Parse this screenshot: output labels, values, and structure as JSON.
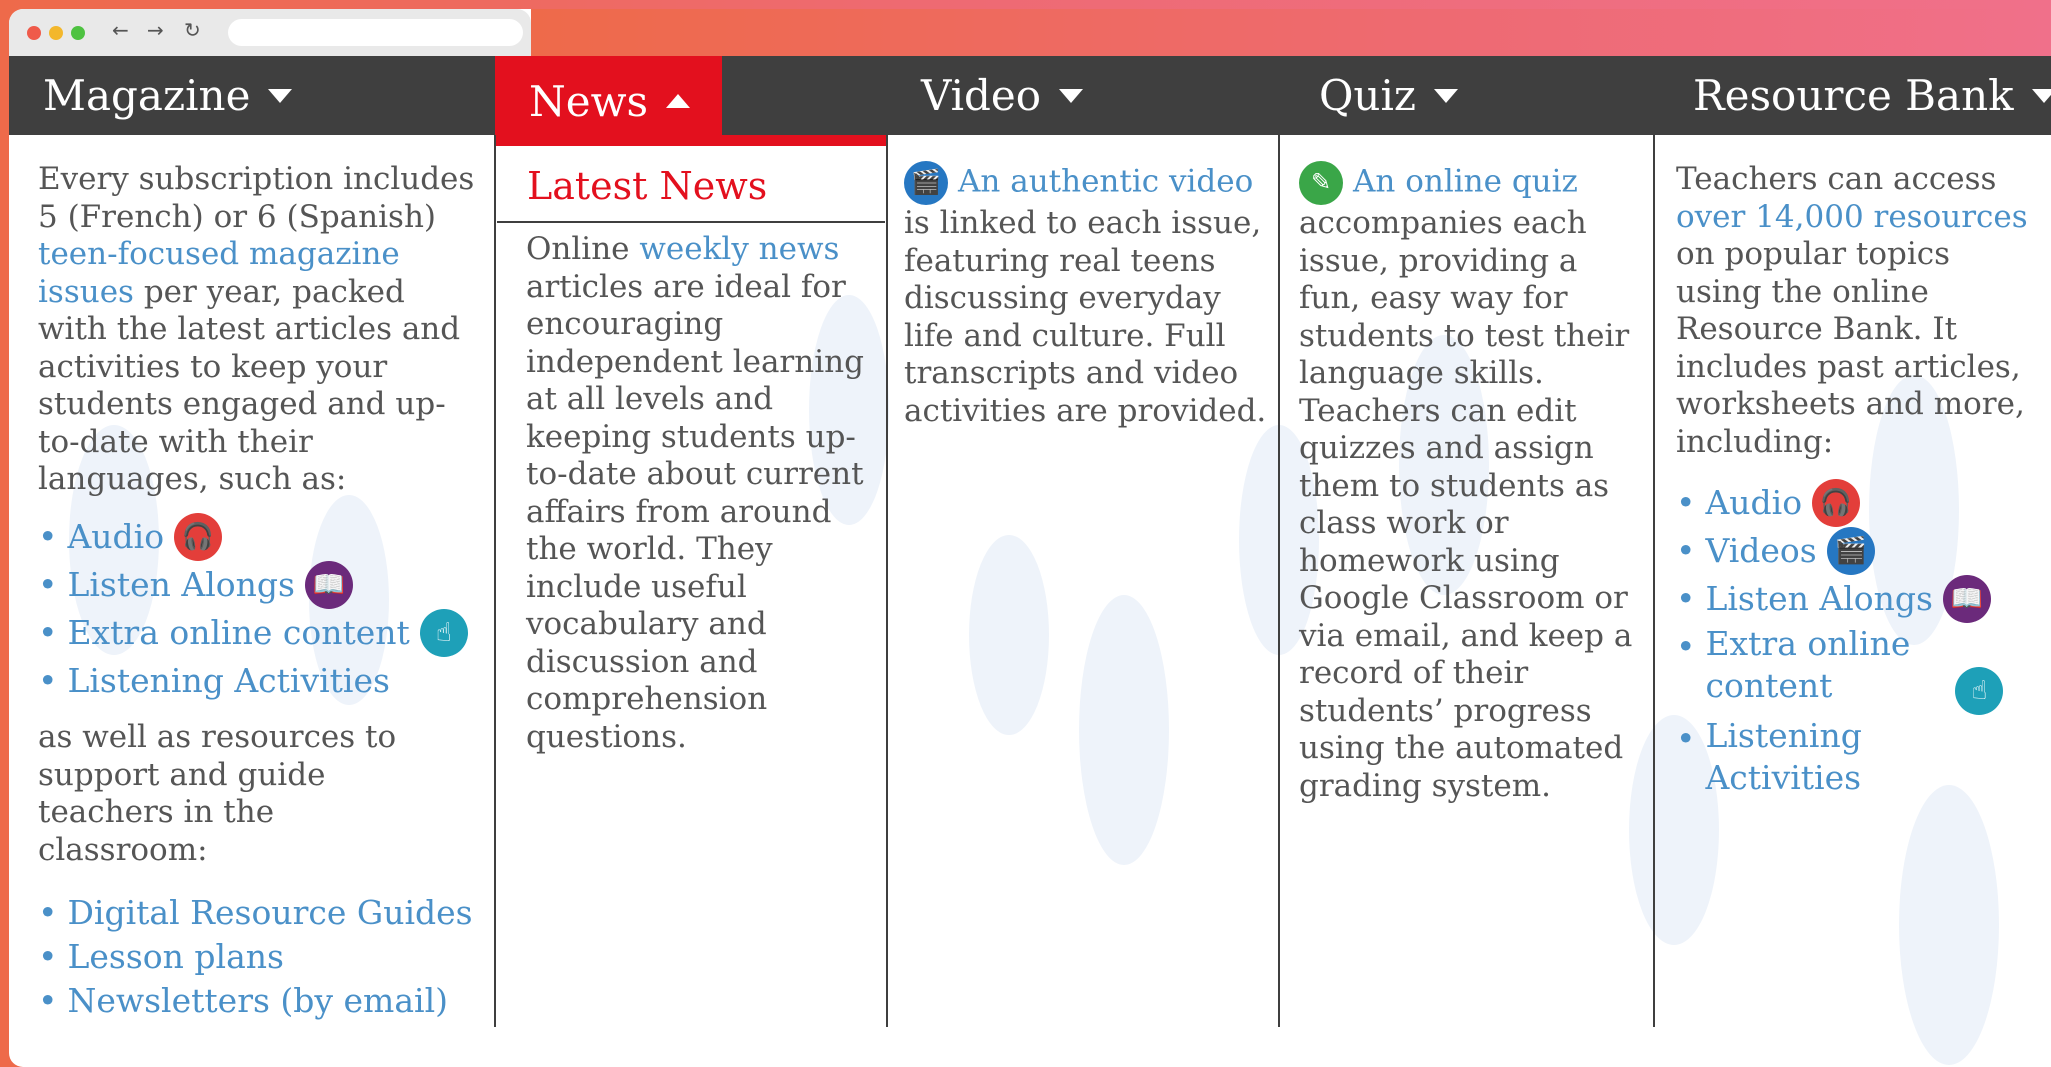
{
  "browser": {
    "back": "←",
    "forward": "→",
    "reload": "↻",
    "url": ""
  },
  "tabs": [
    {
      "label": "Magazine",
      "active": false
    },
    {
      "label": "News",
      "active": true
    },
    {
      "label": "Video",
      "active": false
    },
    {
      "label": "Quiz",
      "active": false
    },
    {
      "label": "Resource Bank",
      "active": false
    }
  ],
  "magazine": {
    "intro_1": "Every subscription includes 5 (French) or 6 (Spanish)",
    "intro_link": "teen-focused magazine issues",
    "intro_2": "per year, packed with the latest articles and activities to keep your students engaged and up-to-date with their languages, such as:",
    "features": [
      {
        "label": "Audio",
        "icon": "headphones-icon"
      },
      {
        "label": "Listen Alongs",
        "icon": "book-audio-icon"
      },
      {
        "label": "Extra online content",
        "icon": "touch-screen-icon"
      },
      {
        "label": "Listening Activities",
        "icon": ""
      }
    ],
    "middle": "as well as resources to support and guide teachers in the classroom:",
    "resources": [
      "Digital Resource Guides",
      "Lesson plans",
      "Newsletters (by email)"
    ]
  },
  "news": {
    "title": "Latest News",
    "text_1": "Online",
    "link": "weekly news",
    "text_2": "articles are ideal for encouraging independent learning at all levels and keeping students up-to-date about current affairs from around the world. They include useful vocabulary and discussion and comprehension questions."
  },
  "video": {
    "pre": "An",
    "link": "authentic video",
    "text": "is linked to each issue, featuring real teens discussing everyday life and culture. Full transcripts and video activities are provided."
  },
  "quiz": {
    "link": "An online quiz",
    "text": "accompanies each issue, providing a fun, easy way for students to test their language skills. Teachers can edit quizzes and assign them to students as class work or homework using Google Classroom or via email, and keep a record of their students’ progress using the automated grading system."
  },
  "resource_bank": {
    "text_1": "Teachers can access",
    "link": "over 14,000 resources",
    "text_2": "on popular topics using the online Resource Bank. It includes past articles, worksheets and more, including:",
    "items": [
      {
        "label": "Audio",
        "icon": "headphones-icon"
      },
      {
        "label": "Videos",
        "icon": "clapperboard-icon"
      },
      {
        "label": "Listen Alongs",
        "icon": "book-audio-icon"
      },
      {
        "label": "Extra online content",
        "icon": "touch-screen-icon"
      },
      {
        "label": "Listening Activities",
        "icon": ""
      }
    ]
  },
  "colors": {
    "accent_red": "#e3101e",
    "link_blue": "#4a90c8",
    "tab_bar": "#3f3f3f"
  }
}
